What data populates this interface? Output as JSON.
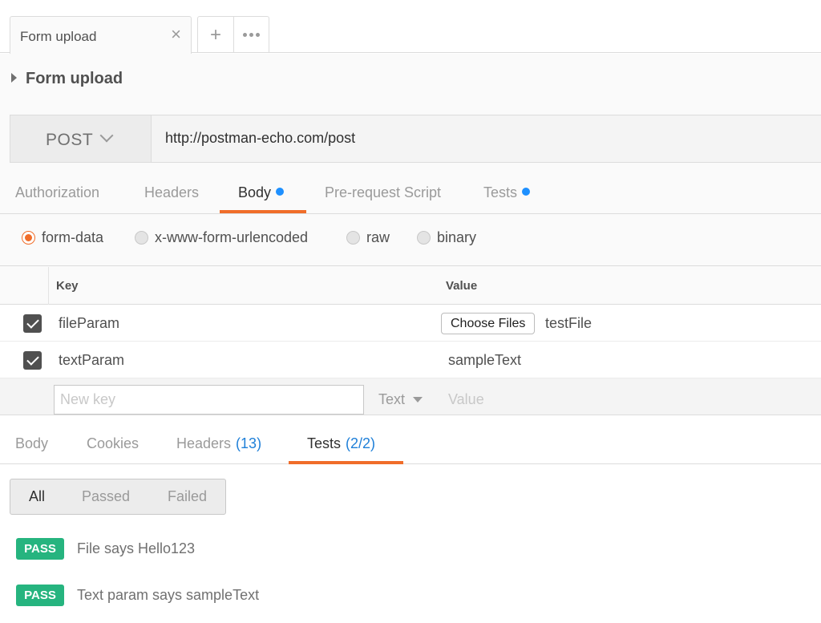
{
  "tabstrip": {
    "active_tab": {
      "label": "Form upload",
      "close_glyph": "×"
    },
    "add_glyph": "+",
    "icons": {
      "add": "plus-icon",
      "more": "more-dots-icon",
      "close": "close-icon"
    }
  },
  "request": {
    "name": "Form upload",
    "method": "POST",
    "url": "http://postman-echo.com/post"
  },
  "request_tabs": [
    {
      "label": "Authorization",
      "active": false,
      "dot": false
    },
    {
      "label": "Headers",
      "active": false,
      "dot": false
    },
    {
      "label": "Body",
      "active": true,
      "dot": true
    },
    {
      "label": "Pre-request Script",
      "active": false,
      "dot": false
    },
    {
      "label": "Tests",
      "active": false,
      "dot": true
    }
  ],
  "body_modes": [
    {
      "label": "form-data",
      "selected": true
    },
    {
      "label": "x-www-form-urlencoded",
      "selected": false
    },
    {
      "label": "raw",
      "selected": false
    },
    {
      "label": "binary",
      "selected": false
    }
  ],
  "params_table": {
    "headers": {
      "key": "Key",
      "value": "Value"
    },
    "rows": [
      {
        "checked": true,
        "key": "fileParam",
        "file_button": "Choose Files",
        "value": "testFile"
      },
      {
        "checked": true,
        "key": "textParam",
        "value": "sampleText"
      }
    ],
    "new_row": {
      "key_placeholder": "New key",
      "type": "Text",
      "value_placeholder": "Value"
    }
  },
  "response_tabs": [
    {
      "label": "Body",
      "count": "",
      "active": false
    },
    {
      "label": "Cookies",
      "count": "",
      "active": false
    },
    {
      "label": "Headers",
      "count": "(13)",
      "active": false
    },
    {
      "label": "Tests",
      "count": "(2/2)",
      "active": true
    }
  ],
  "test_filters": [
    {
      "label": "All",
      "active": true
    },
    {
      "label": "Passed",
      "active": false
    },
    {
      "label": "Failed",
      "active": false
    }
  ],
  "test_results": [
    {
      "status": "PASS",
      "label": "File says Hello123"
    },
    {
      "status": "PASS",
      "label": "Text param says sampleText"
    }
  ],
  "colors": {
    "accent": "#f06d2a",
    "dot": "#1e90ff",
    "pass": "#26b47f",
    "count": "#1e7fd8"
  }
}
